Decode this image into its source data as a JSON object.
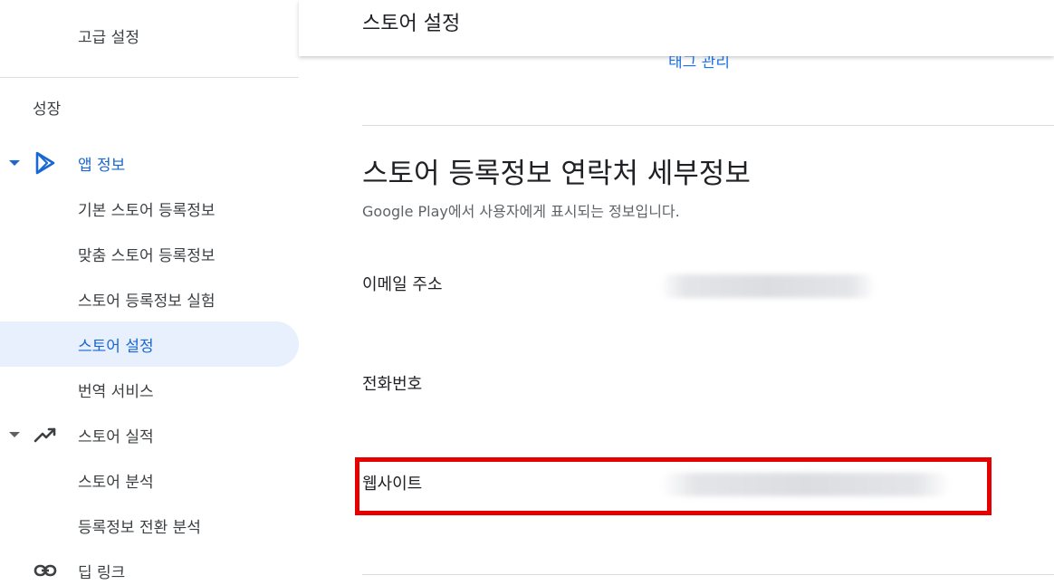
{
  "sidebar": {
    "advanced_settings": "고급 설정",
    "growth_section": "성장",
    "app_info": "앱 정보",
    "items": [
      {
        "label": "기본 스토어 등록정보"
      },
      {
        "label": "맞춤 스토어 등록정보"
      },
      {
        "label": "스토어 등록정보 실험"
      },
      {
        "label": "스토어 설정"
      },
      {
        "label": "번역 서비스"
      }
    ],
    "store_performance": "스토어 실적",
    "perf_items": [
      {
        "label": "스토어 분석"
      },
      {
        "label": "등록정보 전환 분석"
      }
    ],
    "deep_links": "딥 링크"
  },
  "header": {
    "title": "스토어 설정"
  },
  "main": {
    "cut_link": "태그 관리",
    "section_title": "스토어 등록정보 연락처 세부정보",
    "section_desc": "Google Play에서 사용자에게 표시되는 정보입니다.",
    "fields": {
      "email_label": "이메일 주소",
      "phone_label": "전화번호",
      "website_label": "웹사이트"
    }
  },
  "colors": {
    "accent": "#1967d2",
    "selected_bg": "#e8f0fe",
    "highlight": "#e60000"
  }
}
